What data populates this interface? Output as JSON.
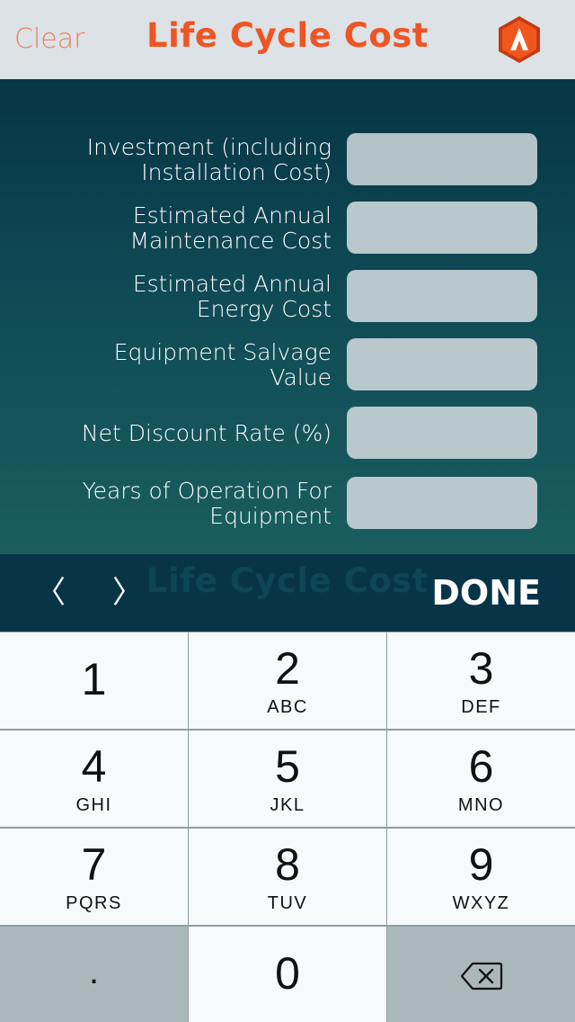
{
  "header": {
    "clear_label": "Clear",
    "title": "Life Cycle Cost",
    "logo_icon": "app-logo-icon",
    "title_color": "#ef5524",
    "clear_color": "#e9805f"
  },
  "form": {
    "fields": [
      {
        "label": "Investment (including\nInstallation Cost)",
        "value": ""
      },
      {
        "label": "Estimated Annual\nMaintenance Cost",
        "value": ""
      },
      {
        "label": "Estimated Annual\nEnergy Cost",
        "value": ""
      },
      {
        "label": "Equipment Salvage\nValue",
        "value": ""
      },
      {
        "label": "Net Discount Rate (%)",
        "value": ""
      },
      {
        "label": "Years of Operation For \nEquipment",
        "value": ""
      }
    ]
  },
  "toolbar": {
    "prev_icon": "chevron-left-icon",
    "next_icon": "chevron-right-icon",
    "prev_glyph": "〈",
    "next_glyph": "〉",
    "watermark": "Life Cycle Cost",
    "done_label": "DONE"
  },
  "keypad": {
    "keys": [
      {
        "num": "1",
        "letters": ""
      },
      {
        "num": "2",
        "letters": "ABC"
      },
      {
        "num": "3",
        "letters": "DEF"
      },
      {
        "num": "4",
        "letters": "GHI"
      },
      {
        "num": "5",
        "letters": "JKL"
      },
      {
        "num": "6",
        "letters": "MNO"
      },
      {
        "num": "7",
        "letters": "PQRS"
      },
      {
        "num": "8",
        "letters": "TUV"
      },
      {
        "num": "9",
        "letters": "WXYZ"
      },
      {
        "num": ".",
        "letters": ""
      },
      {
        "num": "0",
        "letters": ""
      },
      {
        "num": "",
        "letters": "",
        "icon": "backspace-icon"
      }
    ]
  }
}
